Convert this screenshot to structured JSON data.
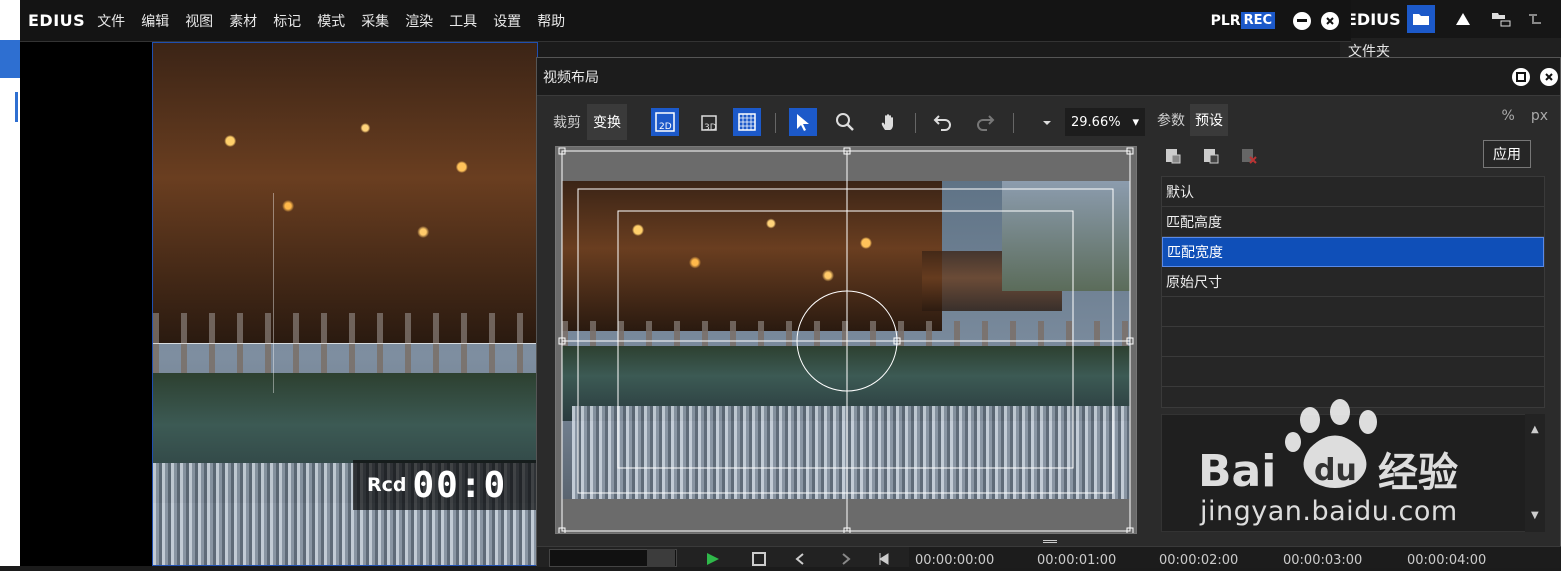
{
  "app": {
    "logo": "EDIUS",
    "menu": [
      "文件",
      "编辑",
      "视图",
      "素材",
      "标记",
      "模式",
      "采集",
      "渲染",
      "工具",
      "设置",
      "帮助"
    ],
    "plr": "PLR",
    "rec": "REC"
  },
  "preview": {
    "rcd_label": "Rcd",
    "timecode": "00:0"
  },
  "bin": {
    "logo": "EDIUS",
    "folder_label": "文件夹"
  },
  "dialog": {
    "title": "视频布局",
    "tabs": [
      "裁剪",
      "变换"
    ],
    "active_tab": "变换",
    "zoom": "29.66%",
    "panel_tabs": [
      "参数",
      "预设"
    ],
    "active_panel_tab": "预设",
    "units": [
      "%",
      "px"
    ],
    "apply_label": "应用",
    "presets": [
      "默认",
      "匹配高度",
      "匹配宽度",
      "原始尺寸"
    ],
    "selected_preset": "匹配宽度",
    "timeline_labels": [
      "00:00:00:00",
      "00:00:01:00",
      "00:00:02:00",
      "00:00:03:00",
      "00:00:04:00"
    ]
  },
  "watermark": {
    "brand": "Bai du 经验",
    "url": "jingyan.baidu.com"
  },
  "colors": {
    "accent": "#1c59c9",
    "selected_row": "#0f4fb8"
  }
}
